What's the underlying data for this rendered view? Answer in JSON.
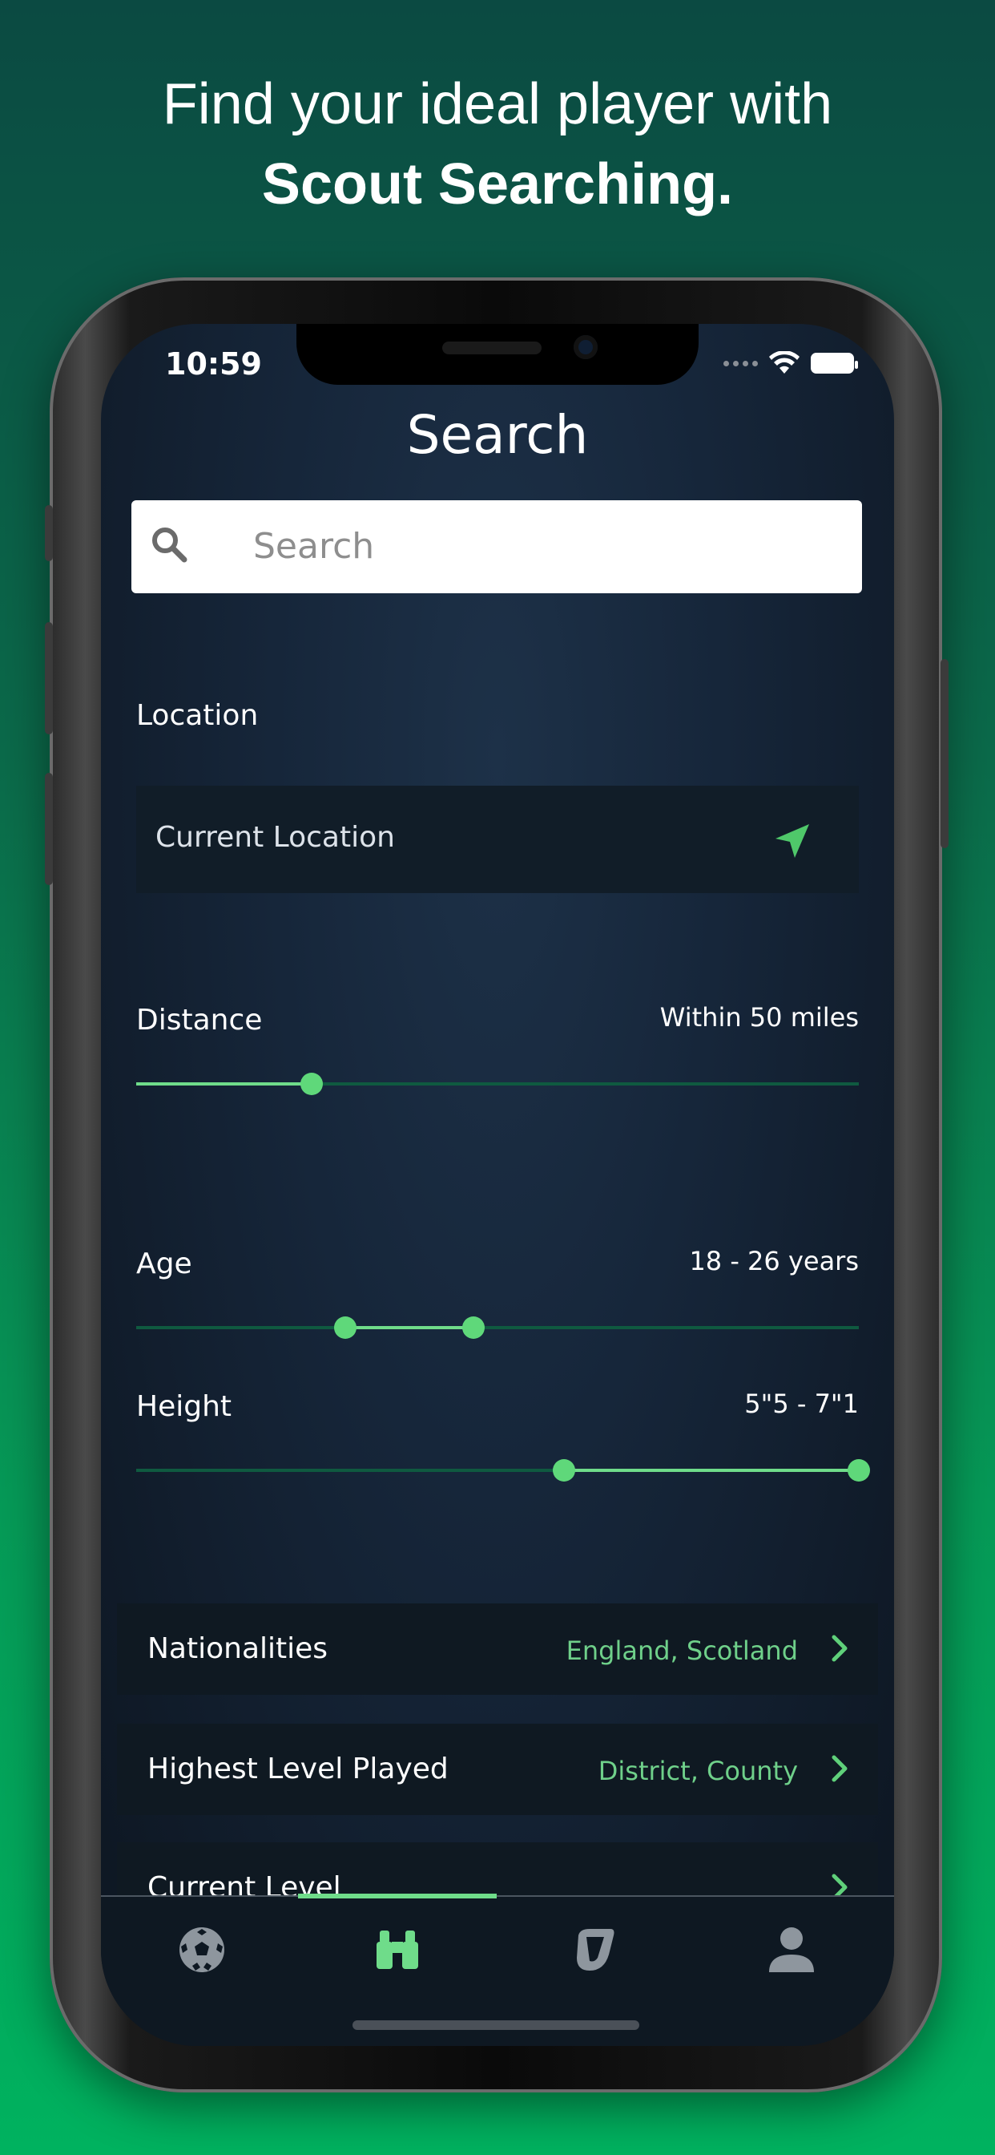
{
  "headline": {
    "line1": "Find your ideal player with",
    "line2": "Scout Searching."
  },
  "status_bar": {
    "time": "10:59"
  },
  "screen": {
    "title": "Search"
  },
  "search": {
    "placeholder": "Search"
  },
  "location": {
    "label": "Location",
    "value": "Current Location"
  },
  "distance": {
    "label": "Distance",
    "value_text": "Within 50 miles",
    "slider_fraction": 0.243
  },
  "age": {
    "label": "Age",
    "value_text": "18 - 26 years",
    "range_fraction": [
      0.289,
      0.467
    ]
  },
  "height": {
    "label": "Height",
    "value_text": "5\"5 - 7\"1",
    "range_fraction": [
      0.592,
      1.0
    ]
  },
  "filters": [
    {
      "label": "Nationalities",
      "value": "England, Scotland"
    },
    {
      "label": "Highest Level Played",
      "value": "District, County"
    },
    {
      "label": "Current Level",
      "value": ""
    }
  ],
  "tabs": [
    {
      "icon": "football-icon",
      "active": false
    },
    {
      "icon": "binoculars-icon",
      "active": true
    },
    {
      "icon": "whistle-icon",
      "active": false
    },
    {
      "icon": "profile-icon",
      "active": false
    }
  ],
  "colors": {
    "accent": "#5fd87a",
    "value_green": "#6fd08a",
    "background_top": "#0b4a42",
    "background_bottom": "#00b25f"
  }
}
